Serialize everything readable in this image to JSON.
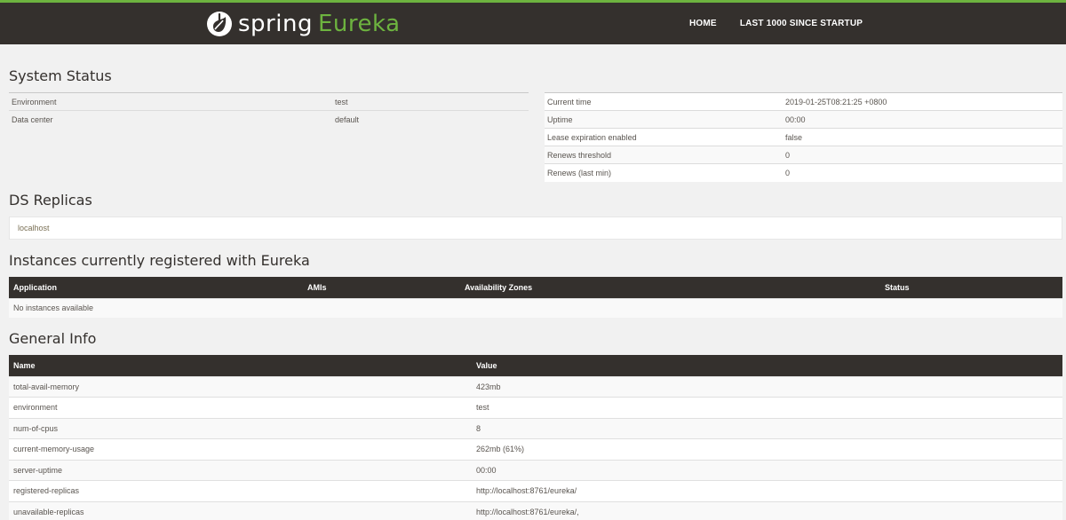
{
  "header": {
    "brand_spring": "spring",
    "brand_eureka": "Eureka",
    "nav": [
      "HOME",
      "LAST 1000 SINCE STARTUP"
    ],
    "colors": {
      "bar": "#34302d",
      "accent": "#6db33f"
    }
  },
  "system_status": {
    "title": "System Status",
    "left": [
      {
        "label": "Environment",
        "value": "test"
      },
      {
        "label": "Data center",
        "value": "default"
      }
    ],
    "right": [
      {
        "label": "Current time",
        "value": "2019-01-25T08:21:25 +0800"
      },
      {
        "label": "Uptime",
        "value": "00:00"
      },
      {
        "label": "Lease expiration enabled",
        "value": "false"
      },
      {
        "label": "Renews threshold",
        "value": "0"
      },
      {
        "label": "Renews (last min)",
        "value": "0"
      }
    ]
  },
  "replicas": {
    "title": "DS Replicas",
    "items": [
      "localhost"
    ]
  },
  "instances": {
    "title": "Instances currently registered with Eureka",
    "columns": [
      "Application",
      "AMIs",
      "Availability Zones",
      "Status"
    ],
    "empty_text": "No instances available"
  },
  "general_info": {
    "title": "General Info",
    "columns": [
      "Name",
      "Value"
    ],
    "rows": [
      {
        "name": "total-avail-memory",
        "value": "423mb"
      },
      {
        "name": "environment",
        "value": "test"
      },
      {
        "name": "num-of-cpus",
        "value": "8"
      },
      {
        "name": "current-memory-usage",
        "value": "262mb (61%)"
      },
      {
        "name": "server-uptime",
        "value": "00:00"
      },
      {
        "name": "registered-replicas",
        "value": "http://localhost:8761/eureka/"
      },
      {
        "name": "unavailable-replicas",
        "value": "http://localhost:8761/eureka/,"
      }
    ]
  }
}
